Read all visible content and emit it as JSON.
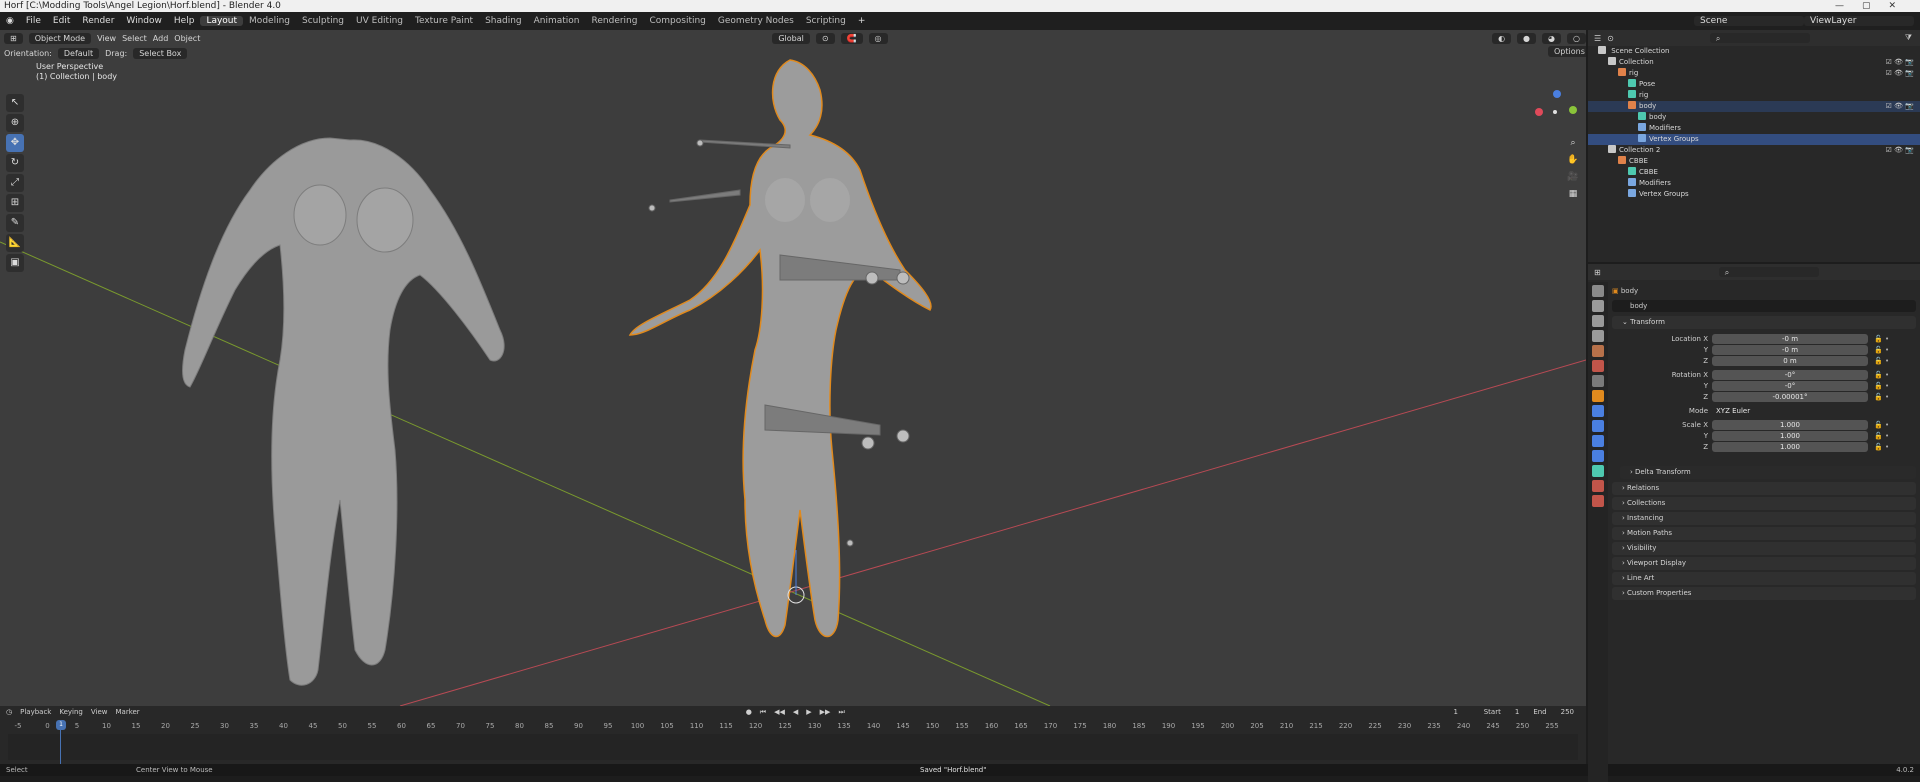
{
  "title": "Horf [C:\\Modding Tools\\Angel Legion\\Horf.blend] - Blender 4.0",
  "menu": [
    "File",
    "Edit",
    "Render",
    "Window",
    "Help"
  ],
  "workspaces": [
    "Layout",
    "Modeling",
    "Sculpting",
    "UV Editing",
    "Texture Paint",
    "Shading",
    "Animation",
    "Rendering",
    "Compositing",
    "Geometry Nodes",
    "Scripting"
  ],
  "active_workspace": "Layout",
  "top_right": {
    "scene": "Scene",
    "view_layer": "ViewLayer"
  },
  "viewport": {
    "mode": "Object Mode",
    "view": "View",
    "select": "Select",
    "add": "Add",
    "object": "Object",
    "orientation_label": "Orientation:",
    "orientation": "Default",
    "drag_label": "Drag:",
    "drag": "Select Box",
    "transform_space": "Global",
    "options": "Options",
    "info_line1": "User Perspective",
    "info_line2": "(1) Collection | body",
    "gizmo": {
      "x": "X",
      "y": "Y",
      "z": "Z"
    }
  },
  "timeline": {
    "menus": [
      "Playback",
      "Keying",
      "View",
      "Marker"
    ],
    "current_frame": "1",
    "start_label": "Start",
    "start": "1",
    "end_label": "End",
    "end": "250",
    "ticks": [
      "-5",
      "0",
      "5",
      "10",
      "15",
      "20",
      "25",
      "30",
      "35",
      "40",
      "45",
      "50",
      "55",
      "60",
      "65",
      "70",
      "75",
      "80",
      "85",
      "90",
      "95",
      "100",
      "105",
      "110",
      "115",
      "120",
      "125",
      "130",
      "135",
      "140",
      "145",
      "150",
      "155",
      "160",
      "165",
      "170",
      "175",
      "180",
      "185",
      "190",
      "195",
      "200",
      "205",
      "210",
      "215",
      "220",
      "225",
      "230",
      "235",
      "240",
      "245",
      "250",
      "255"
    ]
  },
  "status": {
    "left": "Select",
    "mid": "Center View to Mouse",
    "msg": "Saved \"Horf.blend\"",
    "version": "4.0.2"
  },
  "outliner": {
    "root": "Scene Collection",
    "rows": [
      {
        "label": "Collection",
        "indent": 1,
        "color": "#c8c8c8"
      },
      {
        "label": "rig",
        "indent": 2,
        "color": "#e0824a"
      },
      {
        "label": "Pose",
        "indent": 3,
        "color": "#4ec9b0"
      },
      {
        "label": "rig",
        "indent": 3,
        "color": "#4ec9b0"
      },
      {
        "label": "body",
        "indent": 3,
        "color": "#e0824a"
      },
      {
        "label": "body",
        "indent": 4,
        "color": "#4ec9b0"
      },
      {
        "label": "Modifiers",
        "indent": 4,
        "color": "#7aa7e0"
      },
      {
        "label": "Vertex Groups",
        "indent": 4,
        "color": "#7aa7e0"
      },
      {
        "label": "Collection 2",
        "indent": 1,
        "color": "#c8c8c8"
      },
      {
        "label": "CBBE",
        "indent": 2,
        "color": "#e0824a"
      },
      {
        "label": "CBBE",
        "indent": 3,
        "color": "#4ec9b0"
      },
      {
        "label": "Modifiers",
        "indent": 3,
        "color": "#7aa7e0"
      },
      {
        "label": "Vertex Groups",
        "indent": 3,
        "color": "#7aa7e0"
      }
    ]
  },
  "properties": {
    "object_name": "body",
    "name_field": "body",
    "transform": "Transform",
    "fields": [
      {
        "label": "Location X",
        "value": "-0 m"
      },
      {
        "label": "Y",
        "value": "-0 m"
      },
      {
        "label": "Z",
        "value": "0 m"
      },
      {
        "label": "Rotation X",
        "value": "-0°"
      },
      {
        "label": "Y",
        "value": "-0°"
      },
      {
        "label": "Z",
        "value": "-0.00001°"
      },
      {
        "label": "Mode",
        "value": "XYZ Euler"
      },
      {
        "label": "Scale X",
        "value": "1.000"
      },
      {
        "label": "Y",
        "value": "1.000"
      },
      {
        "label": "Z",
        "value": "1.000"
      }
    ],
    "delta": "Delta Transform",
    "panels": [
      "Relations",
      "Collections",
      "Instancing",
      "Motion Paths",
      "Visibility",
      "Viewport Display",
      "Line Art",
      "Custom Properties"
    ]
  }
}
